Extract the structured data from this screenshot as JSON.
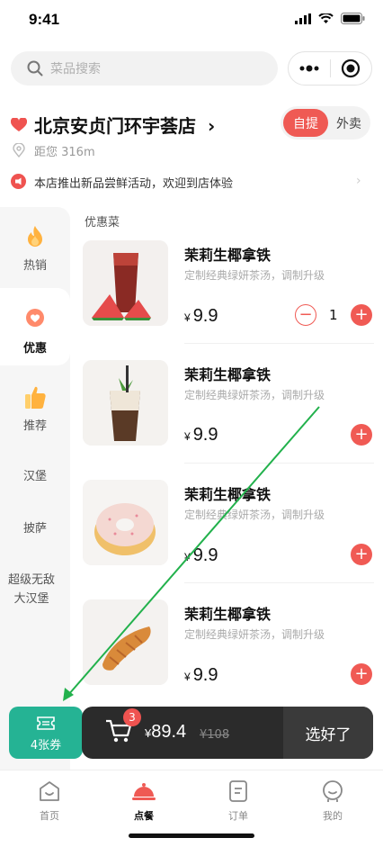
{
  "status": {
    "time": "9:41"
  },
  "search": {
    "placeholder": "菜品搜索"
  },
  "store": {
    "name": "北京安贞门环宇荟店",
    "distance": "距您 316m",
    "modes": {
      "active": "自提",
      "inactive": "外卖"
    }
  },
  "notice": {
    "text": "本店推出新品尝鲜活动，欢迎到店体验"
  },
  "sidebar": {
    "items": [
      {
        "label": "热销"
      },
      {
        "label": "优惠"
      },
      {
        "label": "推荐"
      },
      {
        "label": "汉堡"
      },
      {
        "label": "披萨"
      },
      {
        "label": "超级无敌大汉堡"
      }
    ]
  },
  "section": {
    "title": "优惠菜"
  },
  "products": [
    {
      "name": "茉莉生椰拿铁",
      "desc": "定制经典绿妍茶汤，调制升级",
      "currency": "¥",
      "price": "9.9",
      "qty": "1"
    },
    {
      "name": "茉莉生椰拿铁",
      "desc": "定制经典绿妍茶汤，调制升级",
      "currency": "¥",
      "price": "9.9"
    },
    {
      "name": "茉莉生椰拿铁",
      "desc": "定制经典绿妍茶汤，调制升级",
      "currency": "¥",
      "price": "9.9"
    },
    {
      "name": "茉莉生椰拿铁",
      "desc": "定制经典绿妍茶汤，调制升级",
      "currency": "¥",
      "price": "9.9"
    }
  ],
  "coupon": {
    "label": "4张券"
  },
  "cart": {
    "badge": "3",
    "currency": "¥",
    "price": "89.4",
    "original": "¥108",
    "checkout": "选好了"
  },
  "tabs": [
    {
      "label": "首页"
    },
    {
      "label": "点餐"
    },
    {
      "label": "订单"
    },
    {
      "label": "我的"
    }
  ],
  "colors": {
    "accent": "#ef5a54",
    "coupon": "#25b394",
    "cart": "#2b2b2b",
    "annotation_arrow": "#22b14c"
  }
}
